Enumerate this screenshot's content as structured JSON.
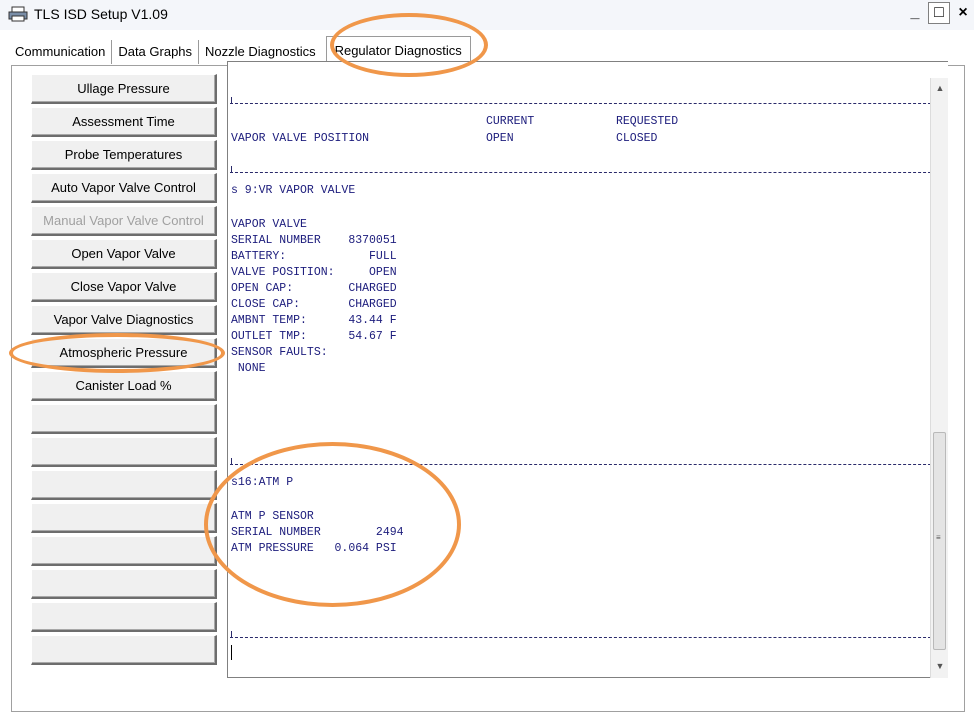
{
  "window": {
    "title": "TLS ISD Setup V1.09",
    "controls": [
      "_",
      "□",
      "×"
    ]
  },
  "tabs": [
    {
      "label": "Communication",
      "active": false
    },
    {
      "label": "Data Graphs",
      "active": false
    },
    {
      "label": "Nozzle Diagnostics",
      "active": false
    },
    {
      "label": "Regulator Diagnostics",
      "active": true
    }
  ],
  "sidebar": {
    "buttons": [
      {
        "label": "Ullage Pressure",
        "enabled": true
      },
      {
        "label": "Assessment Time",
        "enabled": true
      },
      {
        "label": "Probe Temperatures",
        "enabled": true
      },
      {
        "label": "Auto Vapor Valve Control",
        "enabled": true
      },
      {
        "label": "Manual Vapor Valve Control",
        "enabled": false
      },
      {
        "label": "Open Vapor Valve",
        "enabled": true
      },
      {
        "label": "Close Vapor Valve",
        "enabled": true
      },
      {
        "label": "Vapor Valve Diagnostics",
        "enabled": true
      },
      {
        "label": "Atmospheric Pressure",
        "enabled": true
      },
      {
        "label": "Canister Load %",
        "enabled": true
      },
      {
        "label": "",
        "enabled": true
      },
      {
        "label": "",
        "enabled": true
      },
      {
        "label": "",
        "enabled": true
      },
      {
        "label": "",
        "enabled": true
      },
      {
        "label": "",
        "enabled": true
      },
      {
        "label": "",
        "enabled": true
      },
      {
        "label": "",
        "enabled": true
      },
      {
        "label": "",
        "enabled": true
      }
    ]
  },
  "terminal": {
    "header_current": "CURRENT",
    "header_requested": "REQUESTED",
    "valve_row_label": "VAPOR VALVE POSITION",
    "valve_row_current": "OPEN",
    "valve_row_requested": "CLOSED",
    "vr_section_title": "s 9:VR VAPOR VALVE",
    "vr_lines": [
      "VAPOR VALVE",
      "SERIAL NUMBER    8370051",
      "BATTERY:            FULL",
      "VALVE POSITION:     OPEN",
      "OPEN CAP:        CHARGED",
      "CLOSE CAP:       CHARGED",
      "AMBNT TEMP:      43.44 F",
      "OUTLET TMP:      54.67 F",
      "SENSOR FAULTS:",
      " NONE"
    ],
    "atm_section_title": "s16:ATM P",
    "atm_lines": [
      "ATM P SENSOR",
      "SERIAL NUMBER        2494",
      "ATM PRESSURE   0.064 PSI"
    ]
  },
  "colors": {
    "terminal_text": "#1c1c7c",
    "highlight": "#f0974a"
  }
}
